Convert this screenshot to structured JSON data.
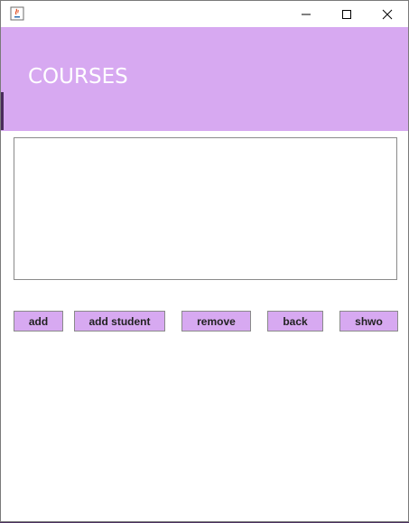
{
  "window": {
    "app_icon": "java-icon",
    "controls": {
      "minimize": "minimize-icon",
      "maximize": "maximize-icon",
      "close": "close-icon"
    }
  },
  "header": {
    "title": "COURSES",
    "color": "#d7a9f1"
  },
  "main": {
    "text_area_value": "",
    "buttons": {
      "add": "add",
      "add_student": "add student",
      "remove": "remove",
      "back": "back",
      "show": "shwo"
    }
  }
}
